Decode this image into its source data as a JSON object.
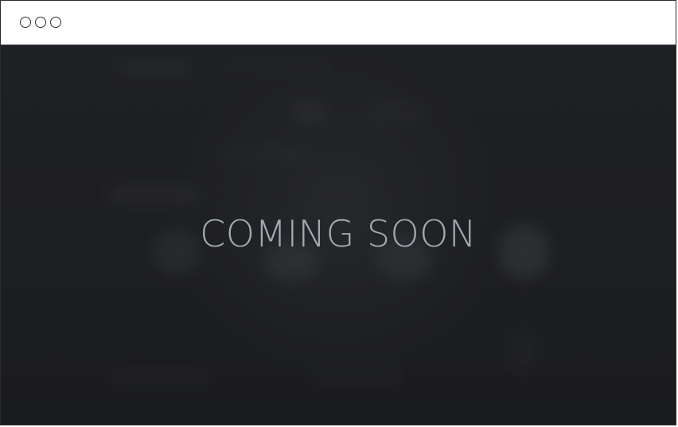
{
  "window": {
    "controls": [
      "window-control-dot-1",
      "window-control-dot-2",
      "window-control-dot-3"
    ]
  },
  "page": {
    "headline": "COMING SOON"
  },
  "colors": {
    "window_border": "#2a2b2e",
    "title_bar": "#ffffff",
    "page_background": "#1f2023",
    "headline": "#a4a8b0"
  }
}
